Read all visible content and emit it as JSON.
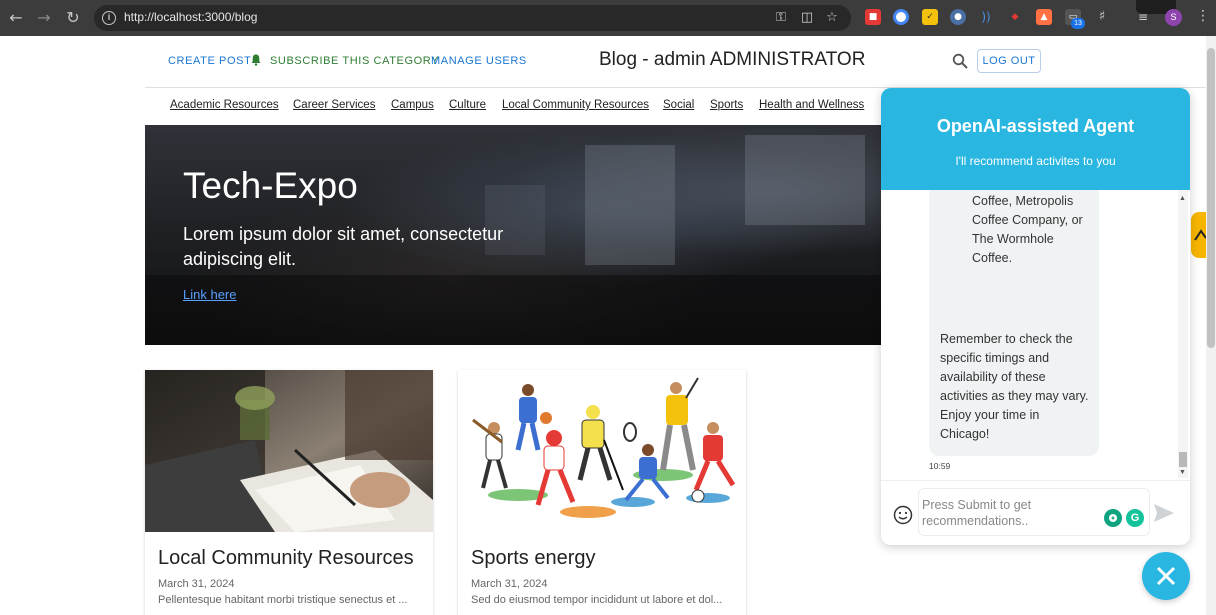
{
  "browser": {
    "url": "http://localhost:3000/blog",
    "extension_badge": "13",
    "profile_initial": "S"
  },
  "header": {
    "create_post": "CREATE POST",
    "subscribe": "SUBSCRIBE THIS CATEGORY",
    "manage_users": "MANAGE USERS",
    "title": "Blog - admin ADMINISTRATOR",
    "logout": "LOG OUT"
  },
  "categories": [
    "Academic Resources",
    "Career Services",
    "Campus",
    "Culture",
    "Local Community Resources",
    "Social",
    "Sports",
    "Health and Wellness"
  ],
  "hero": {
    "title": "Tech-Expo",
    "text": "Lorem ipsum dolor sit amet, consectetur adipiscing elit.",
    "link": "Link here"
  },
  "posts": [
    {
      "title": "Local Community Resources",
      "date": "March 31, 2024",
      "excerpt": "Pellentesque habitant morbi tristique senectus et ..."
    },
    {
      "title": "Sports energy",
      "date": "March 31, 2024",
      "excerpt": "Sed do eiusmod tempor incididunt ut labore et dol..."
    }
  ],
  "chat": {
    "title": "OpenAI-assisted Agent",
    "subtitle": "I'll recommend activites to you",
    "message_part1": "Coffee, Metropolis Coffee Company, or The Wormhole Coffee.",
    "message_part2": "Remember to check the specific timings and availability of these activities as they may vary. Enjoy your time in Chicago!",
    "time": "10:59",
    "placeholder": "Press Submit to get recommendations.."
  },
  "colors": {
    "accent": "#29b6e0",
    "link_blue": "#1976d2",
    "subscribe_green": "#2e7d32",
    "side_tab": "#f7b500"
  }
}
